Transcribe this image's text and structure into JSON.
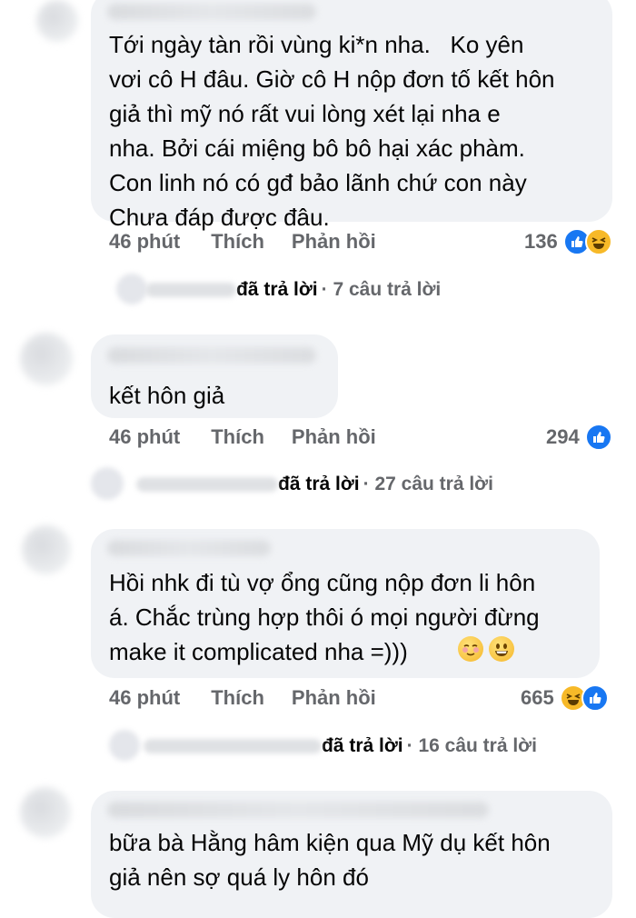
{
  "comments": [
    {
      "text": "Tới ngày tàn rồi vùng ki*n nha.   Ko yên\nvơi cô H đâu. Giờ cô H nộp đơn tố kết hôn\ngiả thì mỹ nó rất vui lòng xét lại nha e\nnha. Bởi cái miệng bô bô hại xác phàm.\nCon linh nó có gđ bảo lãnh chứ con này\nChưa đáp được đâu.",
      "time": "46 phút",
      "like_label": "Thích",
      "reply_label": "Phản hồi",
      "reaction_count": "136",
      "reactions": [
        "like-icon",
        "haha-icon"
      ],
      "replied_label": "đã trả lời",
      "reply_count": "· 7 câu trả lời"
    },
    {
      "text": "kết hôn giả",
      "time": "46 phút",
      "like_label": "Thích",
      "reply_label": "Phản hồi",
      "reaction_count": "294",
      "reactions": [
        "like-icon"
      ],
      "replied_label": "đã trả lời",
      "reply_count": "· 27 câu trả lời"
    },
    {
      "text": "Hồi nhk đi tù vợ ổng cũng nộp đơn li hôn\ná. Chắc trùng hợp thôi ó mọi người đừng\nmake it complicated nha =)))",
      "emojis": [
        "relieved-face",
        "smiling-face"
      ],
      "time": "46 phút",
      "like_label": "Thích",
      "reply_label": "Phản hồi",
      "reaction_count": "665",
      "reactions": [
        "haha-icon",
        "like-icon"
      ],
      "replied_label": "đã trả lời",
      "reply_count": "· 16 câu trả lời"
    },
    {
      "text": "bữa bà Hằng hâm kiện qua Mỹ dụ kết hôn\ngiả nên sợ quá ly hôn đó"
    }
  ],
  "colors": {
    "bubble": "#f0f2f5",
    "meta": "#65676b",
    "text": "#050505",
    "like_blue": "#1877f2",
    "haha_yellow": "#f7b928"
  }
}
